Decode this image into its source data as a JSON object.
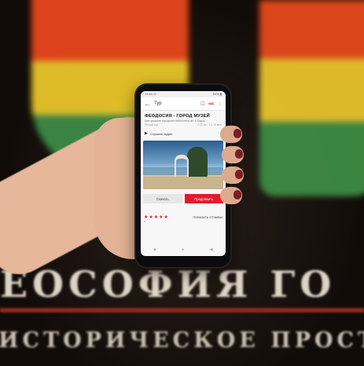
{
  "status": {
    "time": "13:40 ◷",
    "right": "54% ▮"
  },
  "appbar": {
    "back_icon": "arrow-left-icon",
    "title": "Тур"
  },
  "header": {
    "title": "ФЕОДОСИЯ - ГОРОД МУЗЕЙ",
    "subtitle": "Центральная городская библиотека им. А.Грина, ...",
    "meta_left": "Пеший тур",
    "meta_right": "2.22 км · 1 ч 15 мин"
  },
  "listen": {
    "label": "Слушать аудио"
  },
  "buttons": {
    "download": "Скачать",
    "go": "Продолжить"
  },
  "rating": {
    "value": 5,
    "max": 5,
    "stars": "★★★★★",
    "count": "6",
    "reviews_link": "ПОКАЗАТЬ ОТЗЫВЫ"
  },
  "poster": {
    "title": "ЕОСОФИЯ ГО",
    "subtitle": "ИСТОРИЧЕСКОЕ ПРОСТР"
  },
  "colors": {
    "accent": "#e21b2b",
    "flag_red": "#e8471c",
    "flag_yellow": "#e8c52a",
    "flag_green": "#3c8a46"
  }
}
